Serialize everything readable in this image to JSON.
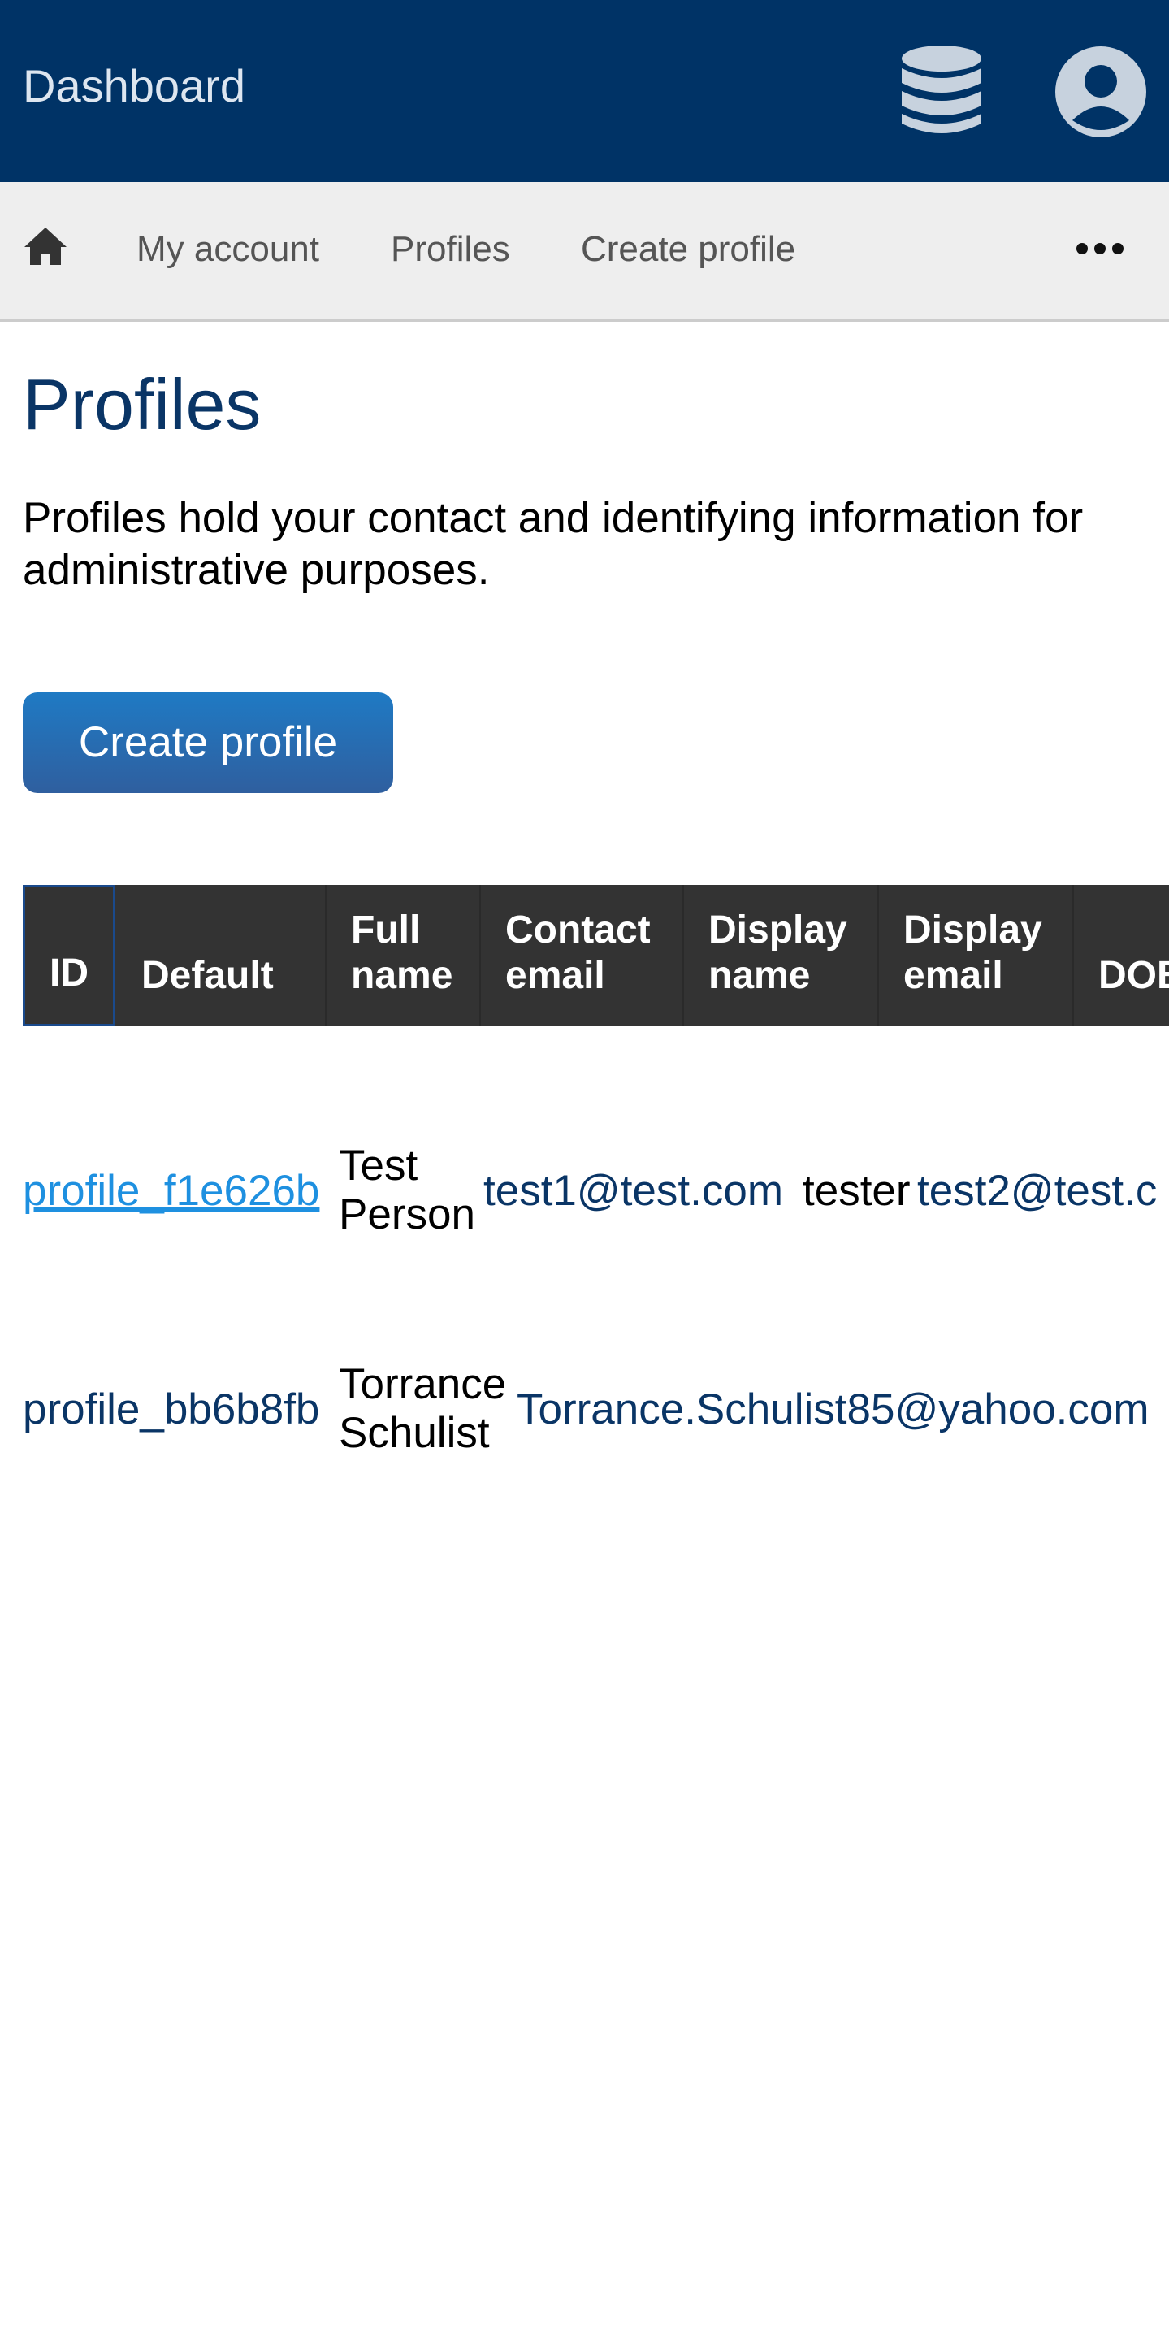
{
  "header": {
    "brand": "Dashboard",
    "icons": [
      "database-icon",
      "user-circle-icon"
    ],
    "background": "#003366"
  },
  "nav": {
    "items": [
      {
        "label": "My account"
      },
      {
        "label": "Profiles"
      },
      {
        "label": "Create profile"
      }
    ],
    "icons": [
      "home-icon",
      "more-icon"
    ]
  },
  "main": {
    "title": "Profiles",
    "intro": "Profiles hold your contact and identifying information for administrative purposes.",
    "create_button": "Create profile",
    "accent": "#1f7ac4"
  },
  "table": {
    "columns": [
      "ID",
      "Default",
      "Full\nname",
      "Contact\nemail",
      "Display\nname",
      "Display\nemail",
      "DOB"
    ],
    "rows": [
      {
        "id": "profile_f1e626b",
        "full_name": "Test\nPerson",
        "contact_email": "test1@test.com",
        "display_name": "tester",
        "display_email": "test2@test.c"
      },
      {
        "id": "profile_bb6b8fb",
        "full_name": "Torrance\nSchulist",
        "contact_email": "Torrance.Schulist85@yahoo.com"
      }
    ]
  }
}
